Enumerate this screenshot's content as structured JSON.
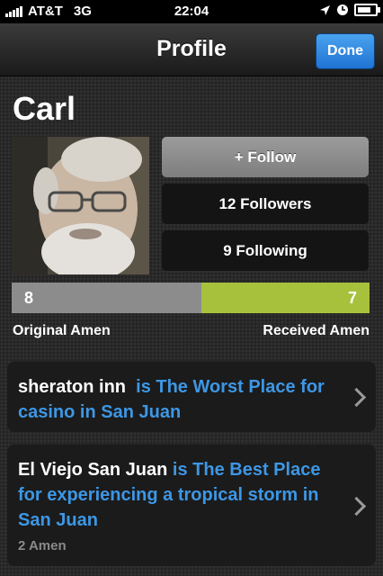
{
  "status_bar": {
    "carrier": "AT&T",
    "network": "3G",
    "time": "22:04"
  },
  "nav": {
    "title": "Profile",
    "done_label": "Done"
  },
  "profile": {
    "name": "Carl",
    "follow_label": "+ Follow",
    "followers_label": "12 Followers",
    "following_label": "9 Following"
  },
  "amen": {
    "original_count": "8",
    "received_count": "7",
    "original_share": 0.53,
    "original_label": "Original Amen",
    "received_label": "Received Amen",
    "original_color": "#8c8c8c",
    "received_color": "#a7c13d"
  },
  "cards": [
    {
      "subject": "sheraton inn",
      "statement": "is The Worst Place for casino in San Juan",
      "sub": ""
    },
    {
      "subject": "El Viejo San Juan",
      "statement": "is The Best Place for experiencing a tropical storm in San Juan",
      "sub": "2 Amen"
    }
  ],
  "colors": {
    "accent_blue": "#3d97e5",
    "done_blue": "#1f73d3"
  },
  "icons": [
    "signal-bars-icon",
    "location-arrow-icon",
    "clock-icon",
    "battery-icon",
    "chevron-right-icon"
  ]
}
